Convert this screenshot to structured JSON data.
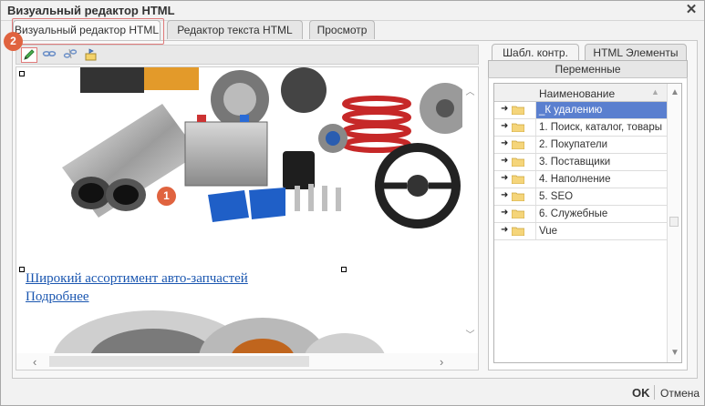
{
  "window": {
    "title": "Визуальный редактор HTML"
  },
  "tabs": [
    {
      "label": "Визуальный редактор HTML"
    },
    {
      "label": "Редактор текста HTML"
    },
    {
      "label": "Просмотр"
    }
  ],
  "toolbar": {
    "buttons": [
      {
        "icon": "pencil-icon"
      },
      {
        "icon": "link-icon"
      },
      {
        "icon": "unlink-icon"
      },
      {
        "icon": "anchor-icon"
      }
    ]
  },
  "editor": {
    "links": [
      "Широкий ассортимент авто-запчастей",
      "Подробнее"
    ]
  },
  "badges": {
    "one": "1",
    "two": "2"
  },
  "right_panel": {
    "tabs": [
      {
        "label": "Шабл. контр."
      },
      {
        "label": "HTML Элементы"
      },
      {
        "label": "Переменные"
      }
    ],
    "column_header": "Наименование",
    "rows": [
      {
        "label": "_К удалению",
        "selected": true
      },
      {
        "label": "1. Поиск, каталог, товары"
      },
      {
        "label": "2. Покупатели"
      },
      {
        "label": "3. Поставщики"
      },
      {
        "label": "4. Наполнение"
      },
      {
        "label": "5. SEO"
      },
      {
        "label": "6. Служебные"
      },
      {
        "label": "Vue"
      }
    ]
  },
  "footer": {
    "ok": "OK",
    "cancel": "Отмена"
  },
  "colors": {
    "accent_highlight": "#e07a7a",
    "badge": "#e0633f",
    "selection": "#5a7fcf",
    "link": "#1a56b0"
  }
}
